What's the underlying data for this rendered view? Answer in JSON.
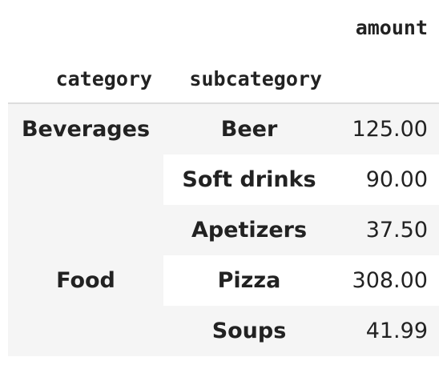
{
  "table": {
    "columns": {
      "value_header": "amount",
      "index_headers": [
        "category",
        "subcategory"
      ]
    },
    "groups": [
      {
        "category": "Beverages",
        "rows": [
          {
            "subcategory": "Beer",
            "amount": "125.00"
          },
          {
            "subcategory": "Soft drinks",
            "amount": "90.00"
          }
        ]
      },
      {
        "category": "Food",
        "rows": [
          {
            "subcategory": "Apetizers",
            "amount": "37.50"
          },
          {
            "subcategory": "Pizza",
            "amount": "308.00"
          },
          {
            "subcategory": "Soups",
            "amount": "41.99"
          }
        ]
      }
    ]
  }
}
